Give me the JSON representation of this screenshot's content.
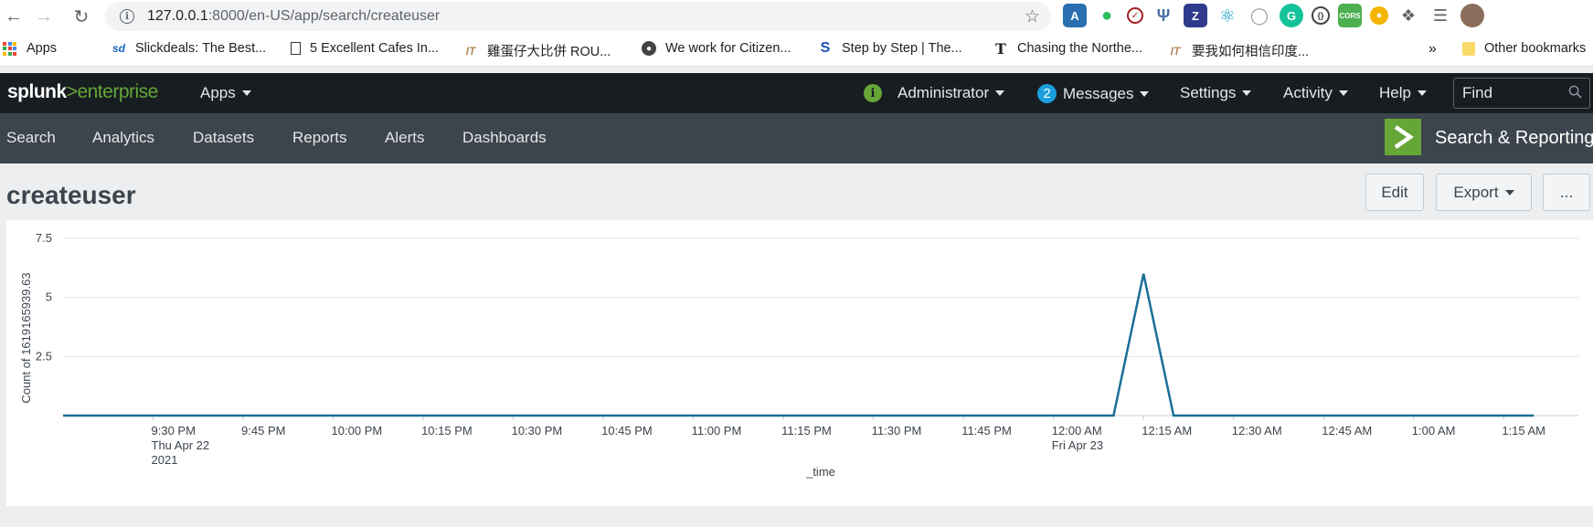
{
  "browser": {
    "url_host": "127.0.0.1",
    "url_rest": ":8000/en-US/app/search/createuser",
    "bookmarks": [
      {
        "label": "Apps",
        "icon": "apps-grid-icon"
      },
      {
        "label": "Slickdeals: The Best...",
        "icon": "slickdeals-icon"
      },
      {
        "label": "5 Excellent Cafes In...",
        "icon": "page-icon"
      },
      {
        "label": "雞蛋仔大比併 ROU...",
        "icon": "it-logo-icon"
      },
      {
        "label": "We work for Citizen...",
        "icon": "globe-icon"
      },
      {
        "label": "Step by Step | The...",
        "icon": "s-logo-icon"
      },
      {
        "label": "Chasing the Northe...",
        "icon": "nyt-icon"
      },
      {
        "label": "要我如何相信印度...",
        "icon": "it-logo-icon"
      }
    ],
    "more_bookmarks": "»",
    "other_bookmarks": "Other bookmarks"
  },
  "splunk": {
    "logo_splunk": "splunk",
    "logo_gt": ">",
    "logo_enterprise": "enterprise",
    "apps_menu": "Apps",
    "admin_menu": "Administrator",
    "messages_count": "2",
    "messages_menu": "Messages",
    "settings_menu": "Settings",
    "activity_menu": "Activity",
    "help_menu": "Help",
    "find_placeholder": "Find"
  },
  "app_nav": {
    "items": [
      "Search",
      "Analytics",
      "Datasets",
      "Reports",
      "Alerts",
      "Dashboards"
    ],
    "app_title": "Search & Reporting"
  },
  "page": {
    "title": "createuser",
    "edit_label": "Edit",
    "export_label": "Export",
    "more_label": "..."
  },
  "colors": {
    "line": "#1a6f97",
    "accent_green": "#65a637",
    "messages_blue": "#1a9fdb"
  },
  "chart_data": {
    "type": "line",
    "ylabel": "Count of 1619165939.63",
    "xlabel": "_time",
    "ylim": [
      0,
      7.5
    ],
    "yticks": [
      2.5,
      5,
      7.5
    ],
    "grid": true,
    "x_tick_labels": [
      [
        "9:30 PM",
        "Thu Apr 22",
        "2021"
      ],
      [
        "9:45 PM"
      ],
      [
        "10:00 PM"
      ],
      [
        "10:15 PM"
      ],
      [
        "10:30 PM"
      ],
      [
        "10:45 PM"
      ],
      [
        "11:00 PM"
      ],
      [
        "11:15 PM"
      ],
      [
        "11:30 PM"
      ],
      [
        "11:45 PM"
      ],
      [
        "12:00 AM",
        "Fri Apr 23"
      ],
      [
        "12:15 AM"
      ],
      [
        "12:30 AM"
      ],
      [
        "12:45 AM"
      ],
      [
        "1:00 AM"
      ],
      [
        "1:15 AM"
      ]
    ],
    "x_range": [
      "2021-04-22 21:15",
      "2021-04-23 01:25"
    ],
    "x": [
      "2021-04-22 21:15",
      "2021-04-23 00:10",
      "2021-04-23 00:15",
      "2021-04-23 00:20",
      "2021-04-23 01:20"
    ],
    "values": [
      0,
      0,
      6,
      0,
      0
    ]
  }
}
